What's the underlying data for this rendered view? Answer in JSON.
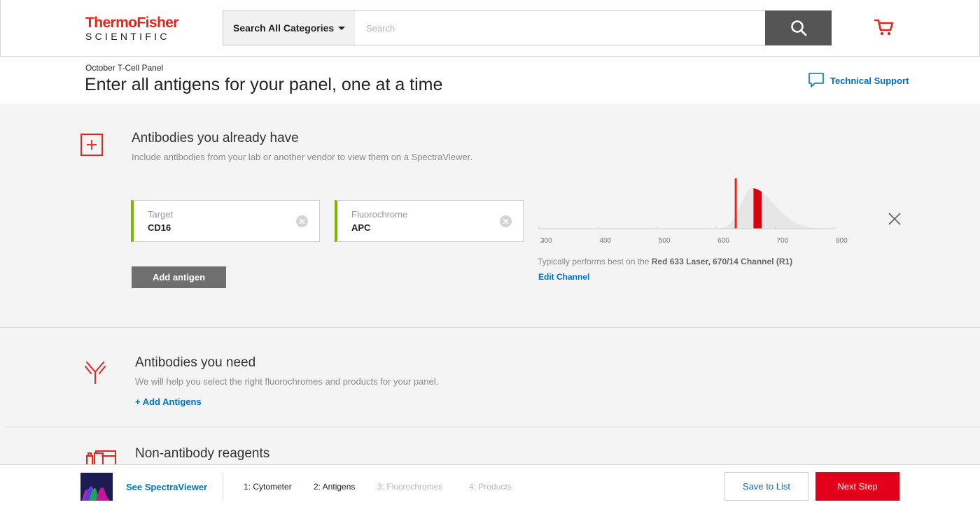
{
  "brand": {
    "line1": "ThermoFisher",
    "line2": "SCIENTIFIC",
    "accent": "#e1261c"
  },
  "header": {
    "category_label": "Search All Categories",
    "search_placeholder": "Search"
  },
  "page": {
    "panel_name": "October T-Cell Panel",
    "title": "Enter all antigens for your panel, one at a time",
    "tech_support": "Technical Support"
  },
  "have_section": {
    "title": "Antibodies you already have",
    "subtitle": "Include antibodies from your lab or another vendor to view them on a SpectraViewer.",
    "target": {
      "label": "Target",
      "value": "CD16"
    },
    "fluorochrome": {
      "label": "Fluorochrome",
      "value": "APC"
    },
    "add_button": "Add antigen",
    "spectrum": {
      "ticks": [
        "300",
        "400",
        "500",
        "600",
        "700",
        "800"
      ],
      "laser_nm": 633,
      "channel_band_nm": [
        663,
        677
      ],
      "range_nm": [
        300,
        800
      ]
    },
    "perf_prefix": "Typically performs best on the ",
    "perf_bold": "Red 633 Laser, 670/14 Channel (R1)",
    "edit_channel": "Edit Channel"
  },
  "need_section": {
    "title": "Antibodies you need",
    "subtitle": "We will help you select the right fluorochromes and products for your panel.",
    "add_link": "+ Add Antigens"
  },
  "reagents_section": {
    "title": "Non-antibody reagents"
  },
  "footer": {
    "see_spectra": "See SpectraViewer",
    "steps": [
      {
        "label": "1: Cytometer",
        "state": "done"
      },
      {
        "label": "2: Antigens",
        "state": "current"
      },
      {
        "label": "3: Fluorochromes",
        "state": "todo"
      },
      {
        "label": "4: Products",
        "state": "todo"
      }
    ],
    "save_label": "Save to List",
    "next_label": "Next Step"
  },
  "colors": {
    "link": "#0071c5",
    "accent_green": "#7ab800",
    "cta": "#e3001b"
  },
  "icons": [
    "search-icon",
    "cart-icon",
    "chat-bubble-icon",
    "plus-icon",
    "clear-icon",
    "close-icon",
    "antibody-icon",
    "reagents-icon"
  ]
}
